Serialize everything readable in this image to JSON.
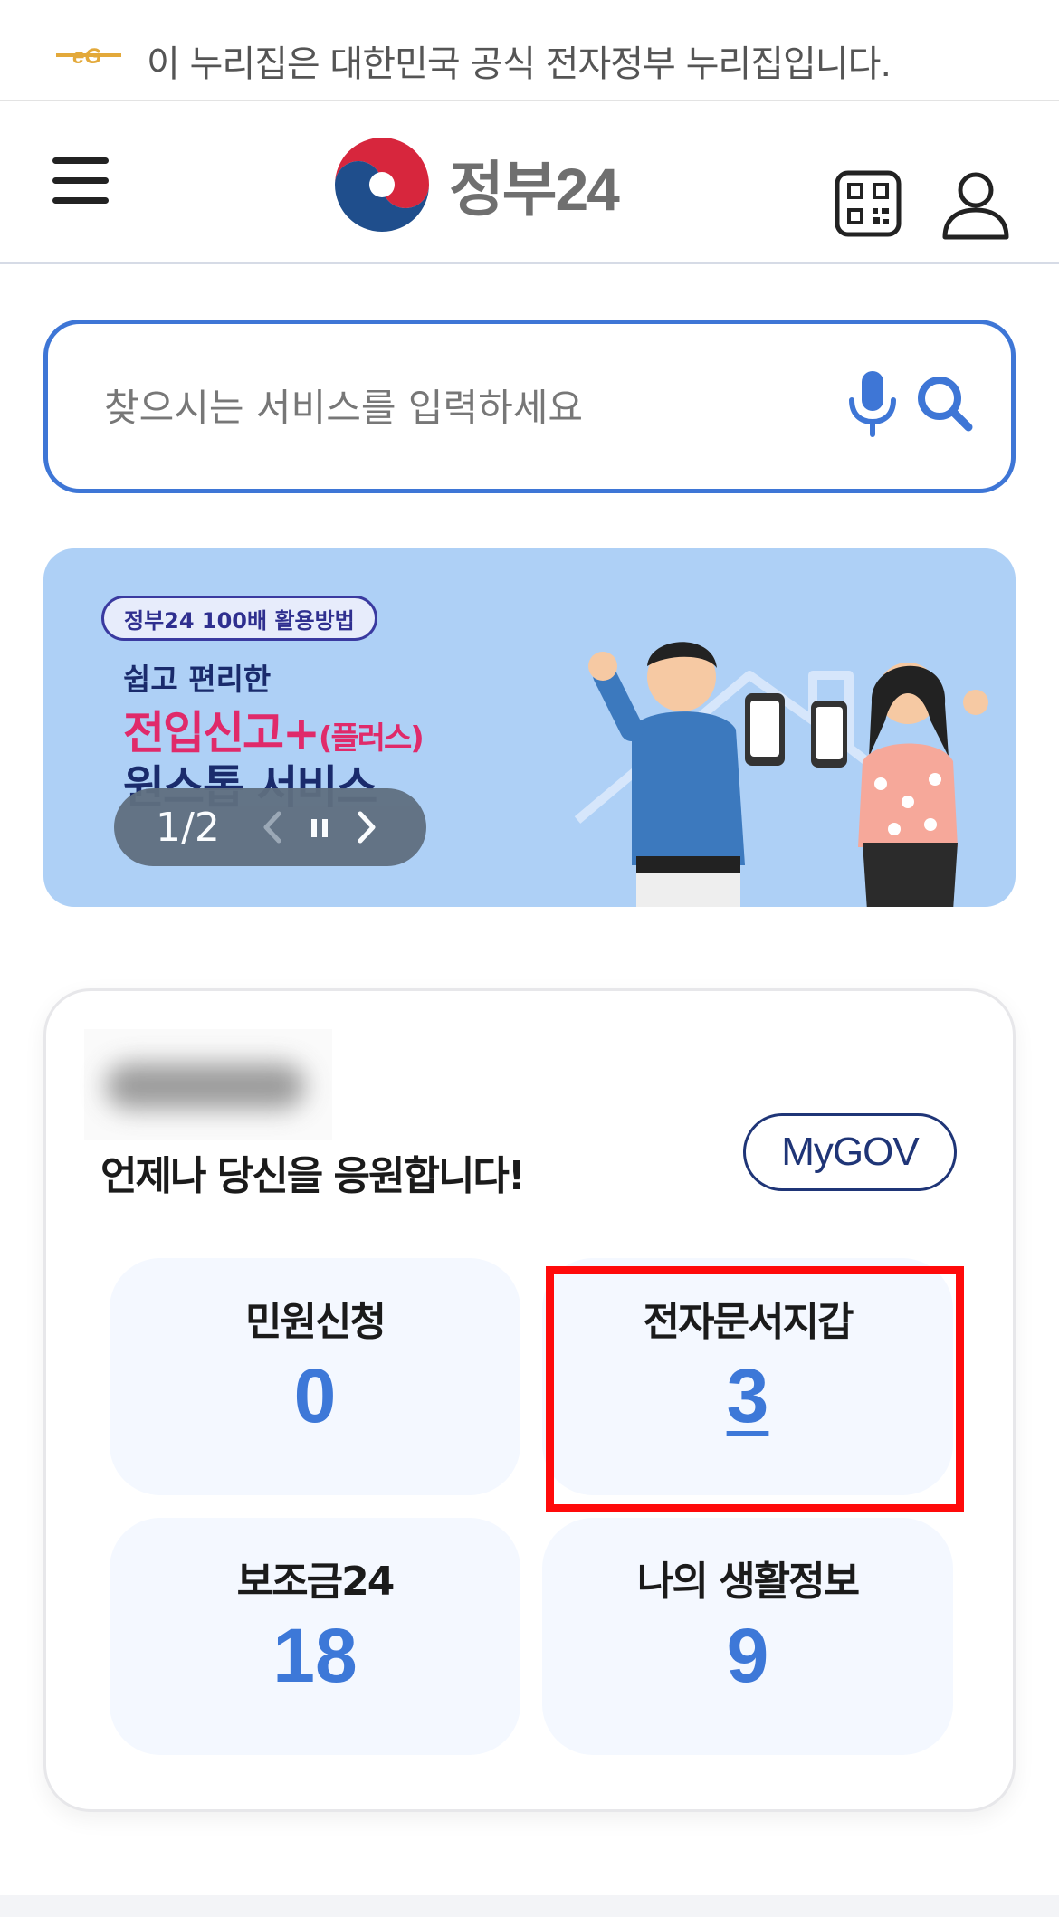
{
  "notice": {
    "text": "이 누리집은 대한민국 공식 전자정부 누리집입니다.",
    "emblem_icon": "eg-emblem-icon"
  },
  "header": {
    "logo_text": "정부24",
    "menu_icon": "hamburger-menu-icon",
    "qr_icon": "qr-code-icon",
    "user_icon": "user-icon"
  },
  "search": {
    "placeholder": "찾으시는 서비스를 입력하세요",
    "value": "",
    "mic_icon": "microphone-icon",
    "search_icon": "search-icon"
  },
  "banner": {
    "tag": "정부24 100배 활용방법",
    "line1": "쉽고 편리한",
    "line2_main": "전입신고+",
    "line2_sub": "(플러스)",
    "line3": "원스톱 서비스",
    "counter": "1/2",
    "colors": {
      "background": "#aed0f6",
      "accent": "#e02a6a",
      "navy": "#1a2b6c"
    }
  },
  "dashboard": {
    "cheer": "언제나 당신을 응원합니다!",
    "mygov_label": "MyGOV",
    "tiles": [
      {
        "label": "민원신청",
        "count": "0"
      },
      {
        "label": "전자문서지갑",
        "count": "3"
      },
      {
        "label": "보조금24",
        "count": "18"
      },
      {
        "label": "나의 생활정보",
        "count": "9"
      }
    ],
    "colors": {
      "count": "#3d78d8",
      "tile_bg": "#f4f8ff",
      "highlight": "#ff0a0a"
    }
  }
}
